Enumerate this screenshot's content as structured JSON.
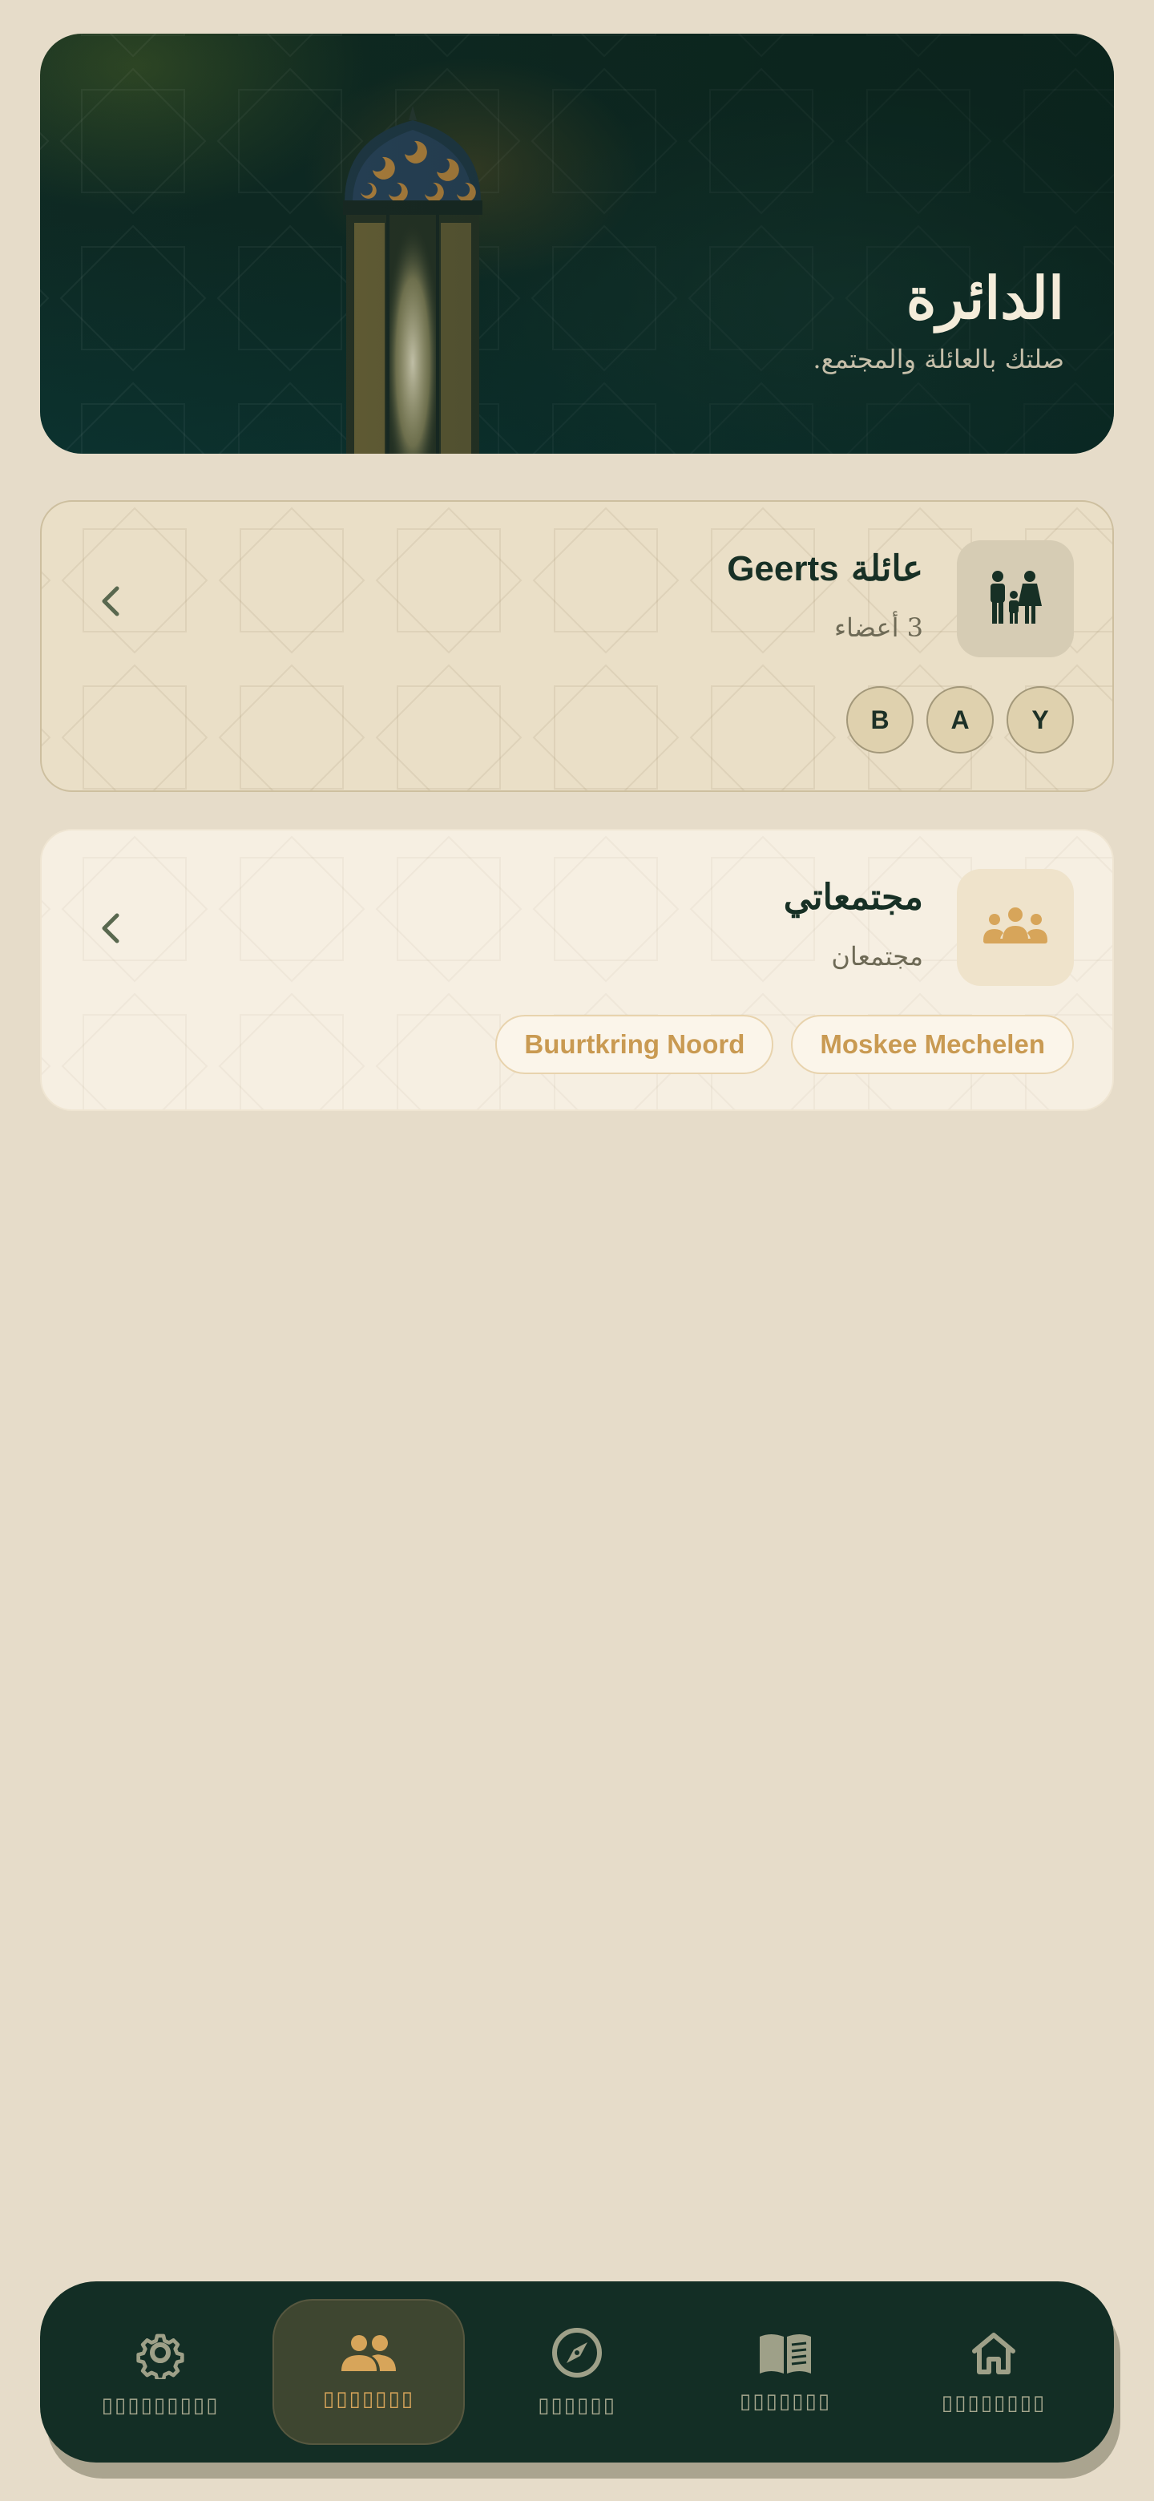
{
  "colors": {
    "background": "#e6dcc9",
    "hero_dark": "#0f2a22",
    "accent_gold": "#d7a55a",
    "nav_bg": "#132e25",
    "text_dark": "#173025"
  },
  "hero": {
    "title": "الدائرة",
    "subtitle": "صلتك بالعائلة والمجتمع."
  },
  "family_card": {
    "icon": "family-icon",
    "title_prefix": "عائلة",
    "title_name": "Geerts",
    "subtitle": "3 أعضاء",
    "chevron": "chevron-left-icon",
    "members": [
      "Y",
      "A",
      "B"
    ]
  },
  "community_card": {
    "icon": "groups-icon",
    "title": "مجتمعاتي",
    "subtitle": "مجتمعان",
    "chevron": "chevron-left-icon",
    "communities": [
      "Moskee Mechelen",
      "Buurtkring Noord"
    ]
  },
  "bottom_nav": {
    "items": [
      {
        "icon": "home-icon",
        "label": "▯▯▯▯▯▯▯▯",
        "active": false
      },
      {
        "icon": "book-icon",
        "label": "▯▯▯▯▯▯▯",
        "active": false
      },
      {
        "icon": "compass-icon",
        "label": "▯▯▯▯▯▯",
        "active": false
      },
      {
        "icon": "people-icon",
        "label": "▯▯▯▯▯▯▯",
        "active": true
      },
      {
        "icon": "gear-icon",
        "label": "▯▯▯▯▯▯▯▯▯",
        "active": false
      }
    ]
  }
}
